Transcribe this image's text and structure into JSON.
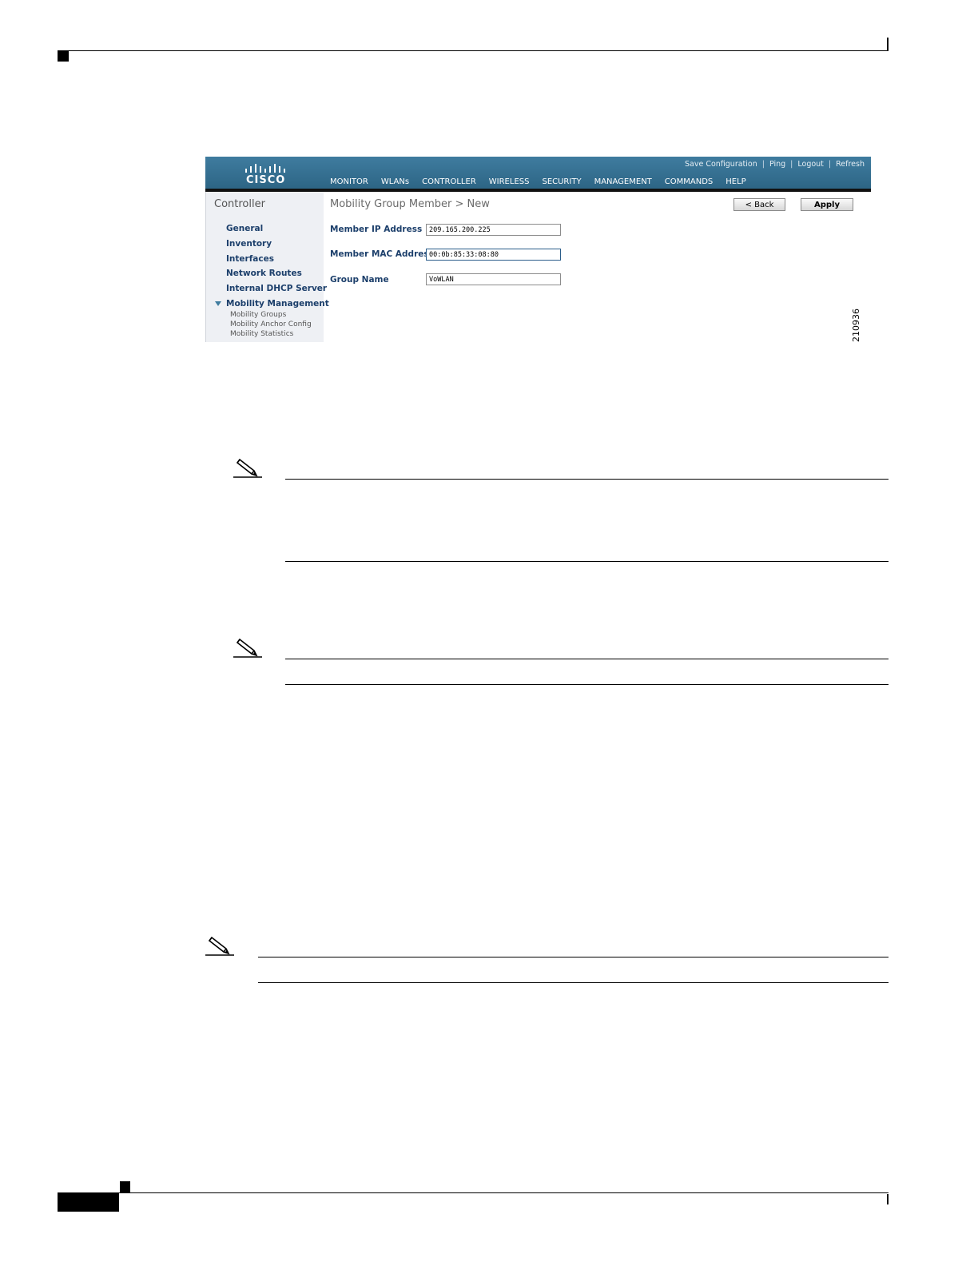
{
  "screenshot": {
    "logo_text": "CISCO",
    "top_links": [
      "Save Configuration",
      "Ping",
      "Logout",
      "Refresh"
    ],
    "nav_tabs": [
      "MONITOR",
      "WLANs",
      "CONTROLLER",
      "WIRELESS",
      "SECURITY",
      "MANAGEMENT",
      "COMMANDS",
      "HELP"
    ],
    "active_tab": "CONTROLLER",
    "sidebar": {
      "title": "Controller",
      "items": [
        "General",
        "Inventory",
        "Interfaces",
        "Network Routes",
        "Internal DHCP Server",
        "Mobility Management"
      ],
      "sub_items": [
        "Mobility Groups",
        "Mobility Anchor Config",
        "Mobility Statistics"
      ]
    },
    "page_title": "Mobility Group Member > New",
    "buttons": {
      "back": "< Back",
      "apply": "Apply"
    },
    "fields": [
      {
        "label": "Member IP Address",
        "value": "209.165.200.225"
      },
      {
        "label": "Member MAC Address",
        "value": "00:0b:85:33:08:80"
      },
      {
        "label": "Group Name",
        "value": "VoWLAN"
      }
    ],
    "figure_number": "210936"
  },
  "colors": {
    "header": "#3a7596",
    "accent": "#f09a2e",
    "link": "#1c3f6b"
  },
  "icons": [
    "note-pencil-icon",
    "cisco-logo-icon"
  ]
}
